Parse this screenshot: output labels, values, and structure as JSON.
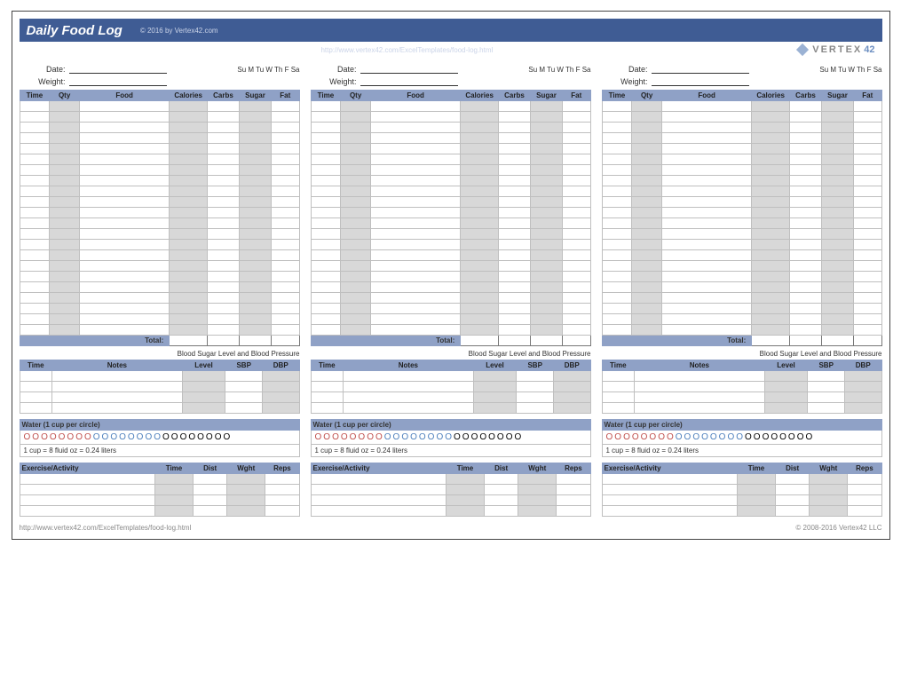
{
  "header": {
    "title": "Daily Food Log",
    "copyright_top": "© 2016 by Vertex42.com",
    "url_top": "http://www.vertex42.com/ExcelTemplates/food-log.html",
    "brand_text": "VERTEX",
    "brand_num": "42"
  },
  "fields": {
    "date_label": "Date:",
    "weight_label": "Weight:",
    "days": "Su  M  Tu  W  Th  F  Sa"
  },
  "food_table": {
    "cols": [
      "Time",
      "Qty",
      "Food",
      "Calories",
      "Carbs",
      "Sugar",
      "Fat"
    ],
    "row_count": 22,
    "total_label": "Total:"
  },
  "bp_section": {
    "title": "Blood Sugar Level and Blood Pressure",
    "cols": [
      "Time",
      "Notes",
      "Level",
      "SBP",
      "DBP"
    ],
    "row_count": 4
  },
  "water": {
    "title": "Water (1 cup per circle)",
    "note": "1 cup = 8 fluid oz = 0.24 liters",
    "circles": {
      "red": 8,
      "blue": 8,
      "black": 8
    }
  },
  "exercise": {
    "cols": [
      "Exercise/Activity",
      "Time",
      "Dist",
      "Wght",
      "Reps"
    ],
    "row_count": 4
  },
  "footer": {
    "url": "http://www.vertex42.com/ExcelTemplates/food-log.html",
    "copyright": "© 2008-2016 Vertex42 LLC"
  }
}
